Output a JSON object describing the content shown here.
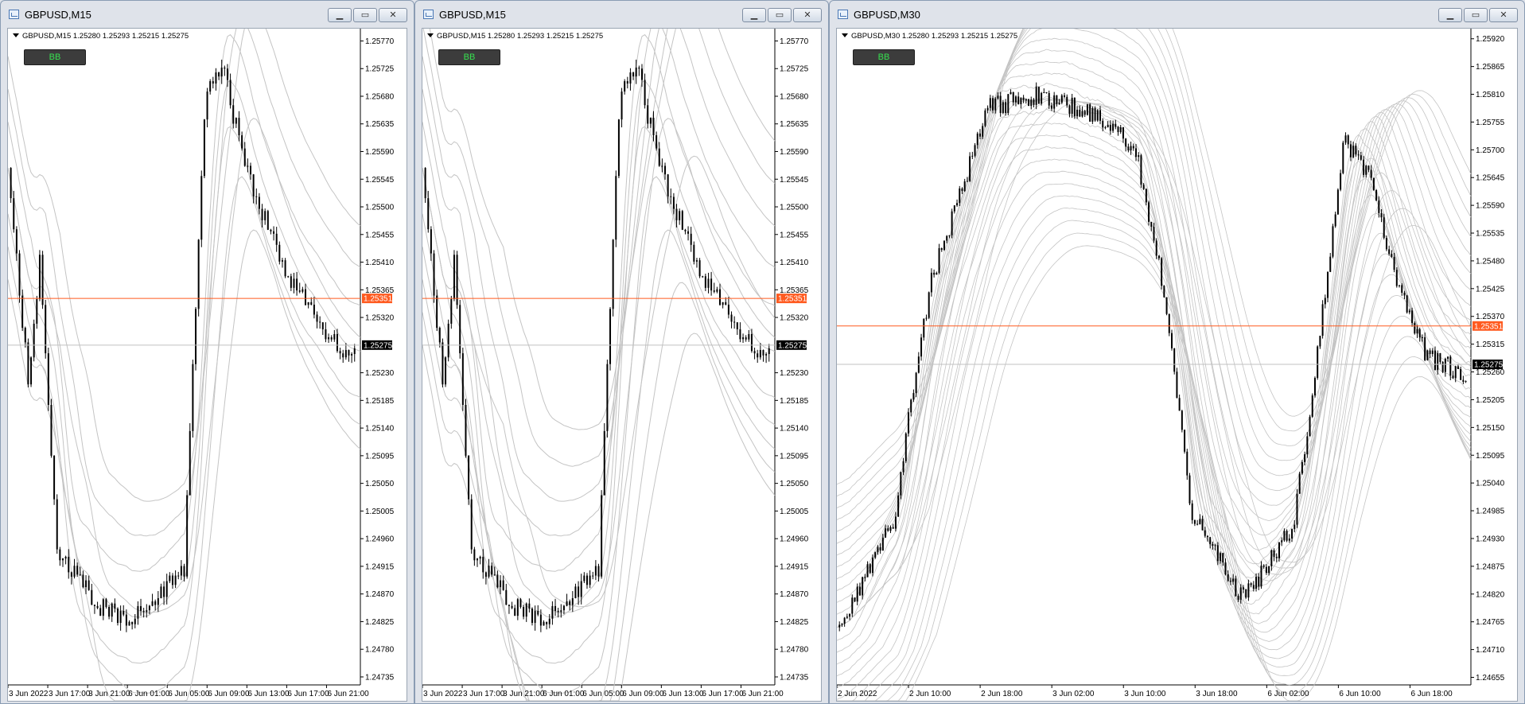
{
  "windows": [
    {
      "id": "w1",
      "state": "active",
      "title": "GBPUSD,M15",
      "symbol_line": "GBPUSD,M15  1.25280 1.25293 1.25215 1.25275",
      "indicator_button": "BB",
      "price_labels": [
        "1.25770",
        "1.25725",
        "1.25680",
        "1.25635",
        "1.25590",
        "1.25545",
        "1.25500",
        "1.25455",
        "1.25410",
        "1.25365",
        "1.25320",
        "1.25230",
        "1.25185",
        "1.25140",
        "1.25095",
        "1.25050",
        "1.25005",
        "1.24960",
        "1.24915",
        "1.24870",
        "1.24825",
        "1.24780",
        "1.24735"
      ],
      "price_range": [
        1.24722,
        1.2579
      ],
      "time_labels": [
        "3 Jun 2022",
        "3 Jun 17:00",
        "3 Jun 21:00",
        "6 Jun 01:00",
        "6 Jun 05:00",
        "6 Jun 09:00",
        "6 Jun 13:00",
        "6 Jun 17:00",
        "6 Jun 21:00"
      ],
      "ask_price": "1.25351",
      "bid_price": "1.25275",
      "band_count": 3,
      "seed": 11
    },
    {
      "id": "w2",
      "state": "inactive",
      "title": "GBPUSD,M15",
      "symbol_line": "GBPUSD,M15  1.25280 1.25293 1.25215 1.25275",
      "indicator_button": "BB",
      "price_labels": [
        "1.25770",
        "1.25725",
        "1.25680",
        "1.25635",
        "1.25590",
        "1.25545",
        "1.25500",
        "1.25455",
        "1.25410",
        "1.25365",
        "1.25320",
        "1.25230",
        "1.25185",
        "1.25140",
        "1.25095",
        "1.25050",
        "1.25005",
        "1.24960",
        "1.24915",
        "1.24870",
        "1.24825",
        "1.24780",
        "1.24735"
      ],
      "price_range": [
        1.24722,
        1.2579
      ],
      "time_labels": [
        "3 Jun 2022",
        "3 Jun 17:00",
        "3 Jun 21:00",
        "6 Jun 01:00",
        "6 Jun 05:00",
        "6 Jun 09:00",
        "6 Jun 13:00",
        "6 Jun 17:00",
        "6 Jun 21:00"
      ],
      "ask_price": "1.25351",
      "bid_price": "1.25275",
      "band_count": 5,
      "seed": 11
    },
    {
      "id": "w3",
      "state": "inactive",
      "title": "GBPUSD,M30",
      "symbol_line": "GBPUSD,M30  1.25280 1.25293 1.25215 1.25275",
      "indicator_button": "BB",
      "price_labels": [
        "1.25920",
        "1.25865",
        "1.25810",
        "1.25755",
        "1.25700",
        "1.25645",
        "1.25590",
        "1.25535",
        "1.25480",
        "1.25425",
        "1.25370",
        "1.25315",
        "1.25260",
        "1.25205",
        "1.25150",
        "1.25095",
        "1.25040",
        "1.24985",
        "1.24930",
        "1.24875",
        "1.24820",
        "1.24765",
        "1.24710",
        "1.24655"
      ],
      "price_range": [
        1.2464,
        1.2594
      ],
      "time_labels": [
        "2 Jun 2022",
        "2 Jun 10:00",
        "2 Jun 18:00",
        "3 Jun 02:00",
        "3 Jun 10:00",
        "3 Jun 18:00",
        "6 Jun 02:00",
        "6 Jun 10:00",
        "6 Jun 18:00"
      ],
      "ask_price": "1.25351",
      "bid_price": "1.25275",
      "band_count": 12,
      "seed": 23
    }
  ],
  "colors": {
    "ask_line": "#ff5a1f",
    "bid_line": "#c0c0c0",
    "candle": "#000000",
    "band": "#c4c4c4",
    "bb_text": "#36e24f",
    "bid_tag_bg": "#000000",
    "ask_tag_bg": "#ff5a1f"
  },
  "icons": {
    "window_icon": "chart-window-icon",
    "minimize": "minimize-icon",
    "maximize": "maximize-icon",
    "close": "close-icon"
  }
}
